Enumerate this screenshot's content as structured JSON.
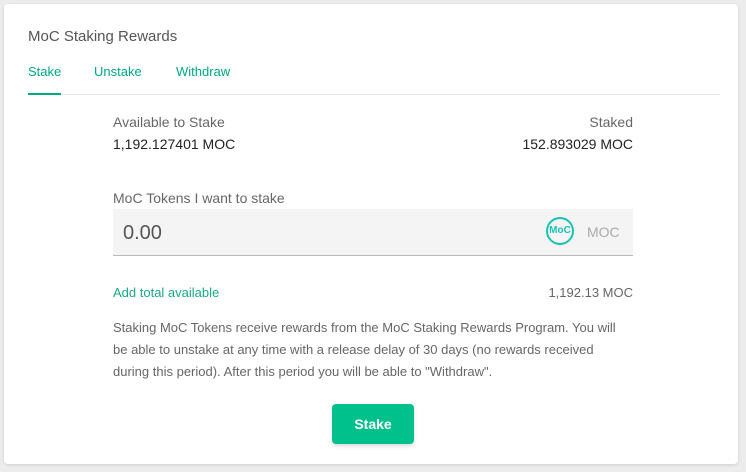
{
  "card": {
    "title": "MoC Staking Rewards"
  },
  "tabs": [
    {
      "label": "Stake",
      "active": true
    },
    {
      "label": "Unstake",
      "active": false
    },
    {
      "label": "Withdraw",
      "active": false
    }
  ],
  "available": {
    "label": "Available to Stake",
    "amount": "1,192.127401",
    "unit": "MOC"
  },
  "staked": {
    "label": "Staked",
    "amount": "152.893029",
    "unit": "MOC"
  },
  "input": {
    "label": "MoC Tokens I want to stake",
    "value": "0.00",
    "icon_text": "MoC",
    "unit": "MOC"
  },
  "add_total": {
    "label": "Add total available",
    "balance": "1,192.13 MOC"
  },
  "description": "Staking MoC Tokens receive rewards from the MoC Staking Rewards Program. You will be able to unstake at any time with a release delay of 30 days (no rewards received during this period). After this period you will be able to \"Withdraw\".",
  "stake_button": {
    "label": "Stake"
  },
  "colors": {
    "accent": "#00a884",
    "button": "#00c08b",
    "icon": "#19c3b2"
  }
}
